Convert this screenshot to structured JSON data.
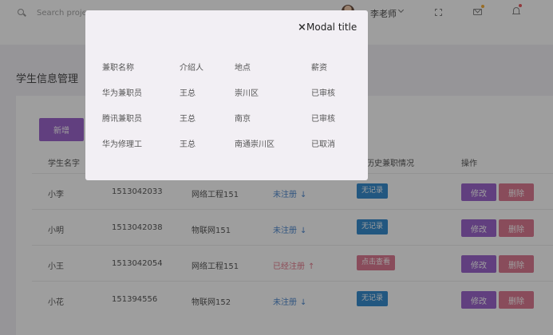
{
  "colors": {
    "primary": "#9153c6",
    "danger": "#d96a86",
    "info": "#1e7ec8",
    "link": "#3a7bc8",
    "warning_text": "#e06b7f",
    "notify": "#f5a623",
    "bell": "#e8474d"
  },
  "header": {
    "search_placeholder": "Search projects",
    "user_name": "李老师",
    "icons": [
      "search-icon",
      "avatar",
      "chevron-down-icon",
      "fullscreen-icon",
      "mail-icon",
      "bell-icon"
    ]
  },
  "page": {
    "title": "学生信息管理",
    "add_label": "新增"
  },
  "table": {
    "columns": [
      "学生名字",
      "",
      "",
      "",
      "往历史兼职情况",
      "操作"
    ],
    "rows": [
      {
        "name": "小李",
        "id": "1513042033",
        "class": "网络工程151",
        "status": "未注册",
        "status_state": "normal",
        "history": "无记录",
        "history_state": "empty",
        "edit": "修改",
        "delete": "删除"
      },
      {
        "name": "小明",
        "id": "1513042038",
        "class": "物联网151",
        "status": "未注册",
        "status_state": "normal",
        "history": "无记录",
        "history_state": "empty",
        "edit": "修改",
        "delete": "删除"
      },
      {
        "name": "小王",
        "id": "1513042054",
        "class": "网络工程151",
        "status": "已经注册",
        "status_state": "registered",
        "history": "点击查看",
        "history_state": "view",
        "edit": "修改",
        "delete": "删除"
      },
      {
        "name": "小花",
        "id": "151394556",
        "class": "物联网152",
        "status": "未注册",
        "status_state": "normal",
        "history": "无记录",
        "history_state": "empty",
        "edit": "修改",
        "delete": "删除"
      }
    ]
  },
  "modal": {
    "close_glyph": "×",
    "title": "Modal title",
    "columns": [
      "兼职名称",
      "介绍人",
      "地点",
      "薪资"
    ],
    "rows": [
      [
        "华为兼职员",
        "王总",
        "崇川区",
        "已审核"
      ],
      [
        "腾讯兼职员",
        "王总",
        "南京",
        "已审核"
      ],
      [
        "华为修理工",
        "王总",
        "南通崇川区",
        "已取消"
      ]
    ]
  }
}
